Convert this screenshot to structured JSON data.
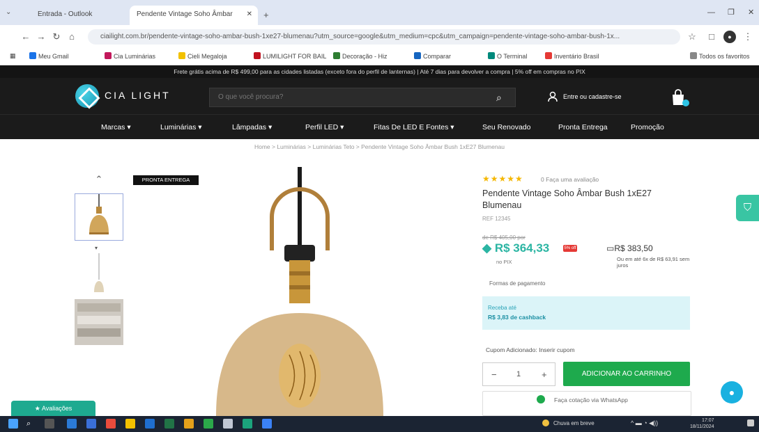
{
  "browser": {
    "tabs": [
      {
        "label": "Entrada - Outlook"
      },
      {
        "label": "Pendente Vintage Soho Âmbar"
      }
    ],
    "url": "ciailight.com.br/pendente-vintage-soho-ambar-bush-1xe27-blumenau?utm_source=google&utm_medium=cpc&utm_campaign=pendente-vintage-soho-ambar-bush-1x...",
    "bookmarks": [
      "Meu Gmail",
      "Cia Luminárias",
      "Cieli Megaloja",
      "LUMILIGHT FOR BAIL",
      "Decoração - Hiz",
      "Comparar",
      "O Terminal",
      "Inventário Brasil",
      "Todos os favoritos"
    ]
  },
  "site": {
    "promo": "Frete grátis acima de R$ 499,00 para as cidades listadas (exceto fora do perfil de lanternas) | Até 7 dias para devolver a compra | 5% off em compras no PIX",
    "logo_text": "CIA LIGHT",
    "search_placeholder": "O que você procura?",
    "account_text": "Entre ou cadastre-se",
    "nav": [
      "Marcas ▾",
      "Luminárias ▾",
      "Lâmpadas ▾",
      "Perfil LED ▾",
      "Fitas De LED E Fontes ▾",
      "Seu Renovado",
      "Pronta Entrega",
      "Promoção"
    ],
    "breadcrumb": "Home > Luminárias > Luminárias Teto > Pendente Vintage Soho Âmbar Bush 1xE27 Blumenau"
  },
  "product": {
    "badge": "PRONTA ENTREGA",
    "reviews": "0 Faça uma avaliação",
    "title": "Pendente Vintage Soho Âmbar Bush 1xE27 Blumenau",
    "sku": "REF 12345",
    "old_price": "de R$ 405,00 por",
    "pix_price": "R$ 364,33",
    "pix_tag": "5% off",
    "pix_label": "no PIX",
    "card_price": "R$ 383,50",
    "installments": "Ou em até 6x de R$ 63,91 sem juros",
    "payment_link": "Formas de pagamento",
    "cashback_line1": "Receba até",
    "cashback_line2": "R$ 3,83 de cashback",
    "coupon": "Cupom Adicionado: Inserir cupom",
    "qty": "1",
    "add_to_cart": "ADICIONAR AO CARRINHO",
    "whatsapp": "Faça cotação via WhatsApp",
    "review_tab": "Avaliações",
    "rating": 5
  },
  "taskbar": {
    "weather": "Chuva em breve",
    "time": "17:07",
    "date": "18/11/2024"
  }
}
